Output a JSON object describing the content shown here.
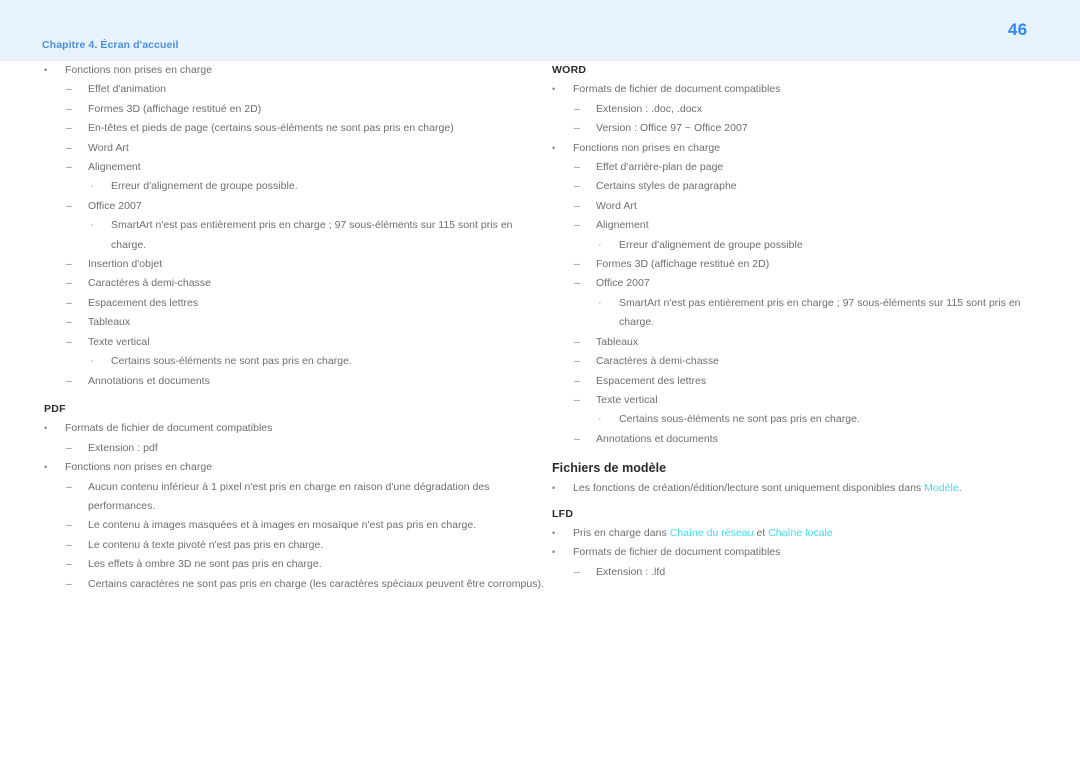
{
  "header": {
    "chapter_label": "Chapitre 4. Écran d'accueil",
    "page_number": "46",
    "band_color": "#e8f2fd",
    "label_color": "#4a90e2",
    "page_number_color": "#2f86f6"
  },
  "theme": {
    "body_text_color": "#6e6e6e",
    "heading_color": "#2b2b2b",
    "highlight_color": "#3fdcf0",
    "page_background": "#ffffff"
  },
  "markers": {
    "level1": "•",
    "level2": "–",
    "level3": "·"
  },
  "left_column": {
    "continued_list": [
      {
        "level": 1,
        "text": "Fonctions non prises en charge"
      },
      {
        "level": 2,
        "text": "Effet d'animation"
      },
      {
        "level": 2,
        "text": "Formes 3D (affichage restitué en 2D)"
      },
      {
        "level": 2,
        "text": "En-têtes et pieds de page (certains sous-éléments ne sont pas pris en charge)"
      },
      {
        "level": 2,
        "text": "Word Art"
      },
      {
        "level": 2,
        "text": "Alignement"
      },
      {
        "level": 3,
        "text": "Erreur d'alignement de groupe possible."
      },
      {
        "level": 2,
        "text": "Office 2007"
      },
      {
        "level": 3,
        "text": "SmartArt n'est pas entièrement pris en charge ; 97 sous-éléments sur 115 sont pris en charge."
      },
      {
        "level": 2,
        "text": "Insertion d'objet"
      },
      {
        "level": 2,
        "text": "Caractères à demi-chasse"
      },
      {
        "level": 2,
        "text": "Espacement des lettres"
      },
      {
        "level": 2,
        "text": "Tableaux"
      },
      {
        "level": 2,
        "text": "Texte vertical"
      },
      {
        "level": 3,
        "text": "Certains sous-éléments ne sont pas pris en charge."
      },
      {
        "level": 2,
        "text": "Annotations et documents"
      }
    ],
    "pdf_section": {
      "heading": "PDF",
      "items": [
        {
          "level": 1,
          "text": "Formats de fichier de document compatibles"
        },
        {
          "level": 2,
          "text": "Extension : pdf"
        },
        {
          "level": 1,
          "text": "Fonctions non prises en charge"
        },
        {
          "level": 2,
          "text": "Aucun contenu inférieur à 1 pixel n'est pris en charge en raison d'une dégradation des performances."
        },
        {
          "level": 2,
          "text": "Le contenu à images masquées et à images en mosaïque n'est pas pris en charge."
        },
        {
          "level": 2,
          "text": "Le contenu à texte pivoté n'est pas pris en charge."
        },
        {
          "level": 2,
          "text": "Les effets à ombre 3D ne sont pas pris en charge."
        },
        {
          "level": 2,
          "text": "Certains caractères ne sont pas pris en charge (les caractères spéciaux peuvent être corrompus)."
        }
      ]
    }
  },
  "right_column": {
    "word_section": {
      "heading": "WORD",
      "items": [
        {
          "level": 1,
          "text": "Formats de fichier de document compatibles"
        },
        {
          "level": 2,
          "text": "Extension : .doc, .docx"
        },
        {
          "level": 2,
          "text": "Version : Office 97 ~ Office 2007"
        },
        {
          "level": 1,
          "text": "Fonctions non prises en charge"
        },
        {
          "level": 2,
          "text": "Effet d'arrière-plan de page"
        },
        {
          "level": 2,
          "text": "Certains styles de paragraphe"
        },
        {
          "level": 2,
          "text": "Word Art"
        },
        {
          "level": 2,
          "text": "Alignement"
        },
        {
          "level": 3,
          "text": "Erreur d'alignement de groupe possible"
        },
        {
          "level": 2,
          "text": "Formes 3D (affichage restitué en 2D)"
        },
        {
          "level": 2,
          "text": "Office 2007"
        },
        {
          "level": 3,
          "text": "SmartArt n'est pas entièrement pris en charge ; 97 sous-éléments sur 115 sont pris en charge."
        },
        {
          "level": 2,
          "text": "Tableaux"
        },
        {
          "level": 2,
          "text": "Caractères à demi-chasse"
        },
        {
          "level": 2,
          "text": "Espacement des lettres"
        },
        {
          "level": 2,
          "text": "Texte vertical"
        },
        {
          "level": 3,
          "text": "Certains sous-éléments ne sont pas pris en charge."
        },
        {
          "level": 2,
          "text": "Annotations et documents"
        }
      ]
    },
    "template_section": {
      "heading": "Fichiers de modèle",
      "line_prefix": "Les fonctions de création/édition/lecture sont uniquement disponibles dans ",
      "line_highlight": "Modèle",
      "line_suffix": "."
    },
    "lfd_section": {
      "heading": "LFD",
      "supported_prefix": "Pris en charge dans ",
      "supported_highlight_1": "Chaîne du réseau",
      "supported_middle": " et ",
      "supported_highlight_2": "Chaîne locale",
      "formats_label": "Formats de fichier de document compatibles",
      "extension_label": "Extension : .lfd"
    }
  }
}
